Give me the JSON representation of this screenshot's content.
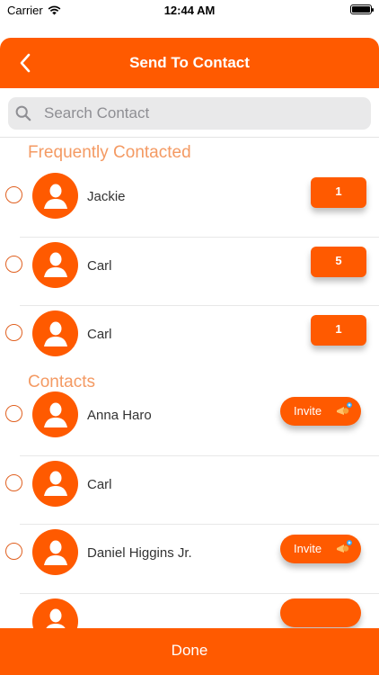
{
  "status_bar": {
    "carrier": "Carrier",
    "time": "12:44 AM"
  },
  "header": {
    "title": "Send To Contact"
  },
  "search": {
    "placeholder": "Search Contact",
    "value": ""
  },
  "sections": {
    "frequent": {
      "title": "Frequently Contacted",
      "items": [
        {
          "name": "Jackie",
          "count": "1"
        },
        {
          "name": "Carl",
          "count": "5"
        },
        {
          "name": "Carl",
          "count": "1"
        }
      ]
    },
    "contacts": {
      "title": "Contacts",
      "items": [
        {
          "name": "Anna Haro",
          "action": "Invite"
        },
        {
          "name": "Carl",
          "action": ""
        },
        {
          "name": "Daniel Higgins Jr.",
          "action": "Invite"
        },
        {
          "name": "",
          "action": ""
        }
      ]
    }
  },
  "footer": {
    "done_label": "Done"
  },
  "colors": {
    "accent": "#ff5a00",
    "section_title": "#f49a63",
    "radio_border": "#e06020"
  }
}
